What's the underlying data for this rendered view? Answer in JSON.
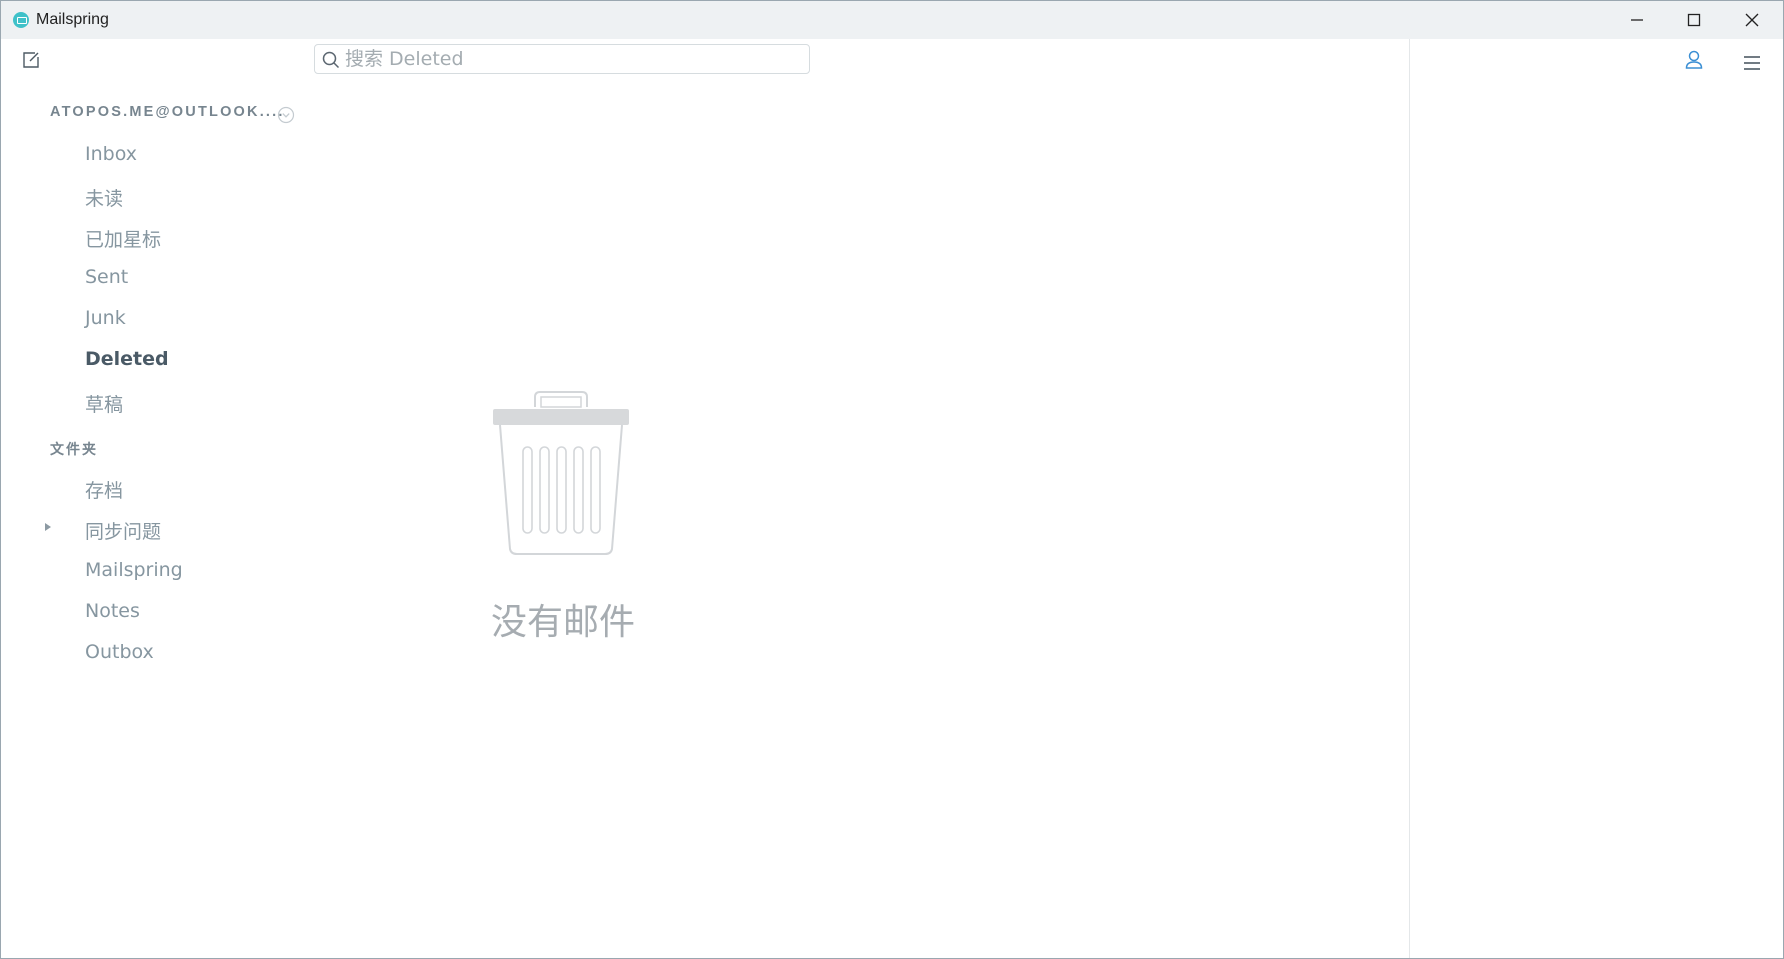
{
  "window": {
    "title": "Mailspring",
    "accent_color": "#3fc1c9"
  },
  "toolbar": {
    "compose_icon": "compose-icon",
    "search_placeholder": "搜索 Deleted",
    "search_value": "",
    "person_icon": "person-icon",
    "menu_icon": "hamburger-menu-icon"
  },
  "sidebar": {
    "account": "ATOPOS.ME@OUTLOOK....",
    "mailboxes": [
      {
        "label": "Inbox"
      },
      {
        "label": "未读"
      },
      {
        "label": "已加星标"
      },
      {
        "label": "Sent"
      },
      {
        "label": "Junk"
      },
      {
        "label": "Deleted",
        "active": true
      },
      {
        "label": "草稿"
      }
    ],
    "folders_header": "文件夹",
    "folders": [
      {
        "label": "存档"
      },
      {
        "label": "同步问题",
        "expandable": true
      },
      {
        "label": "Mailspring"
      },
      {
        "label": "Notes"
      },
      {
        "label": "Outbox"
      }
    ]
  },
  "main": {
    "empty_icon": "trash-can-icon",
    "empty_text": "没有邮件"
  }
}
